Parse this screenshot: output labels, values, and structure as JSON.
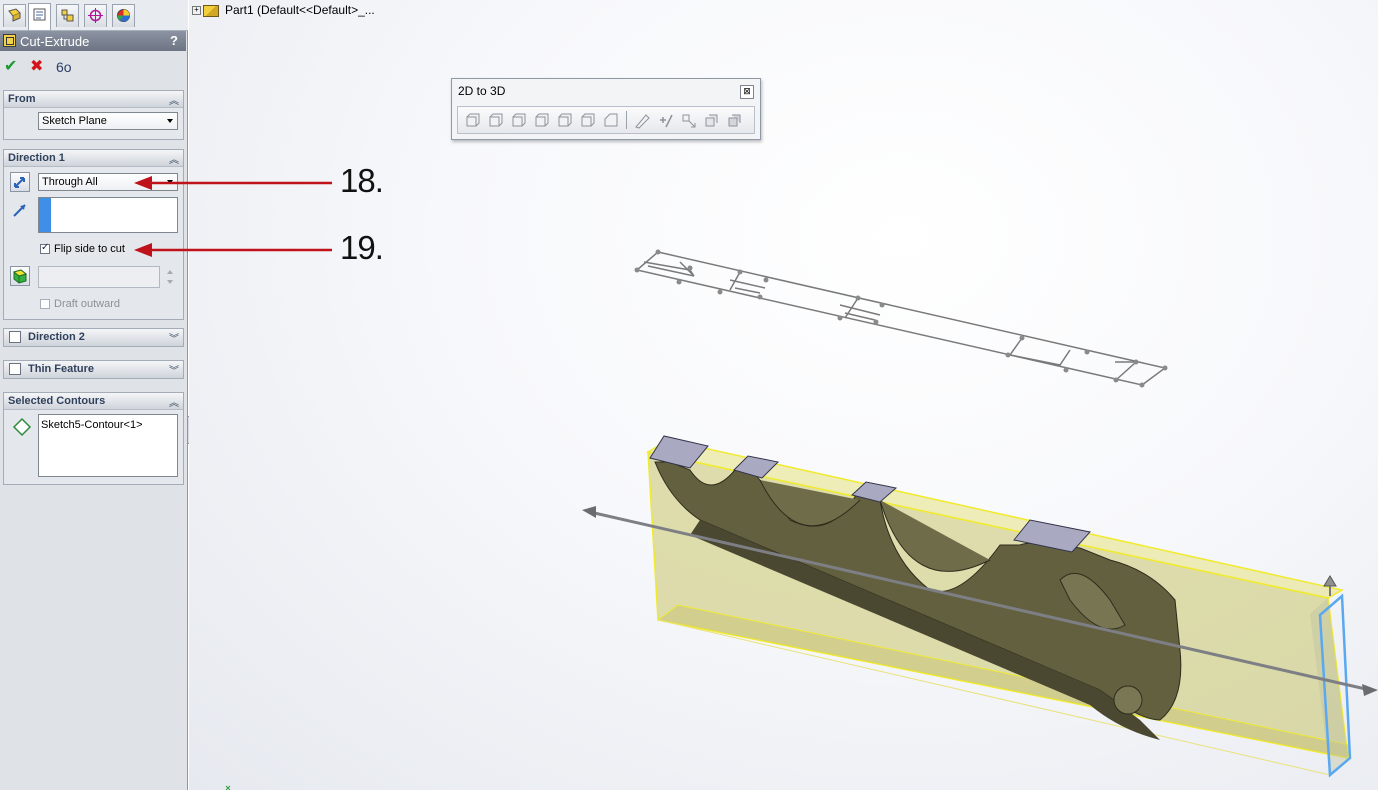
{
  "property_manager": {
    "title": "Cut-Extrude",
    "help": "?",
    "actions": {
      "ok": "✔",
      "cancel": "✖",
      "preview": "6o"
    },
    "from": {
      "header": "From",
      "value": "Sketch Plane"
    },
    "direction1": {
      "header": "Direction 1",
      "end_condition": "Through All",
      "flip_label": "Flip side to cut",
      "flip_checked": true,
      "draft_label": "Draft outward"
    },
    "direction2": {
      "header": "Direction 2"
    },
    "thin_feature": {
      "header": "Thin Feature"
    },
    "selected_contours": {
      "header": "Selected Contours",
      "items": [
        "Sketch5-Contour<1>"
      ]
    }
  },
  "tree": {
    "label": "Part1  (Default<<Default>_..."
  },
  "toolbar": {
    "title": "2D to 3D",
    "close": "⊠"
  },
  "callouts": [
    "18.",
    "19."
  ],
  "colors": {
    "accent_red": "#c0121a",
    "part_yellow": "#d6d25a",
    "preview_edge": "#f0ea30"
  }
}
